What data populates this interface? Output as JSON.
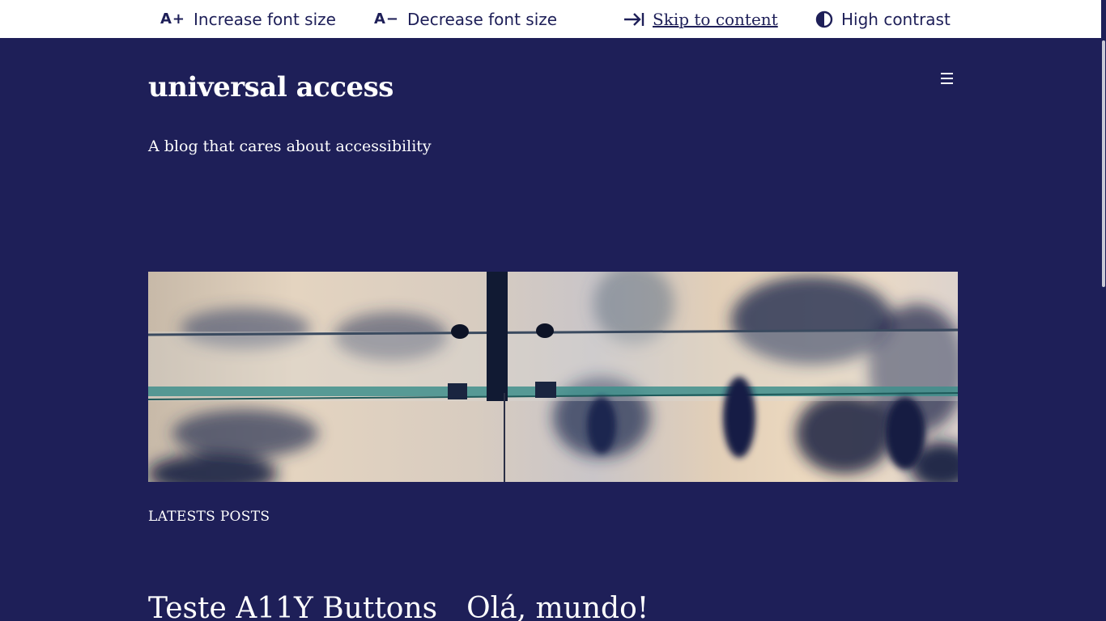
{
  "a11y_bar": {
    "increase_icon_text": "A+",
    "increase_label": "Increase font size",
    "decrease_icon_text": "A−",
    "decrease_label": "Decrease font size",
    "skip_label": "Skip to content",
    "contrast_label": "High contrast"
  },
  "header": {
    "site_title": "universal access",
    "tagline": "A blog that cares about accessibility",
    "menu_icon": "hamburger-menu-icon"
  },
  "main": {
    "section_label": "LATESTS POSTS",
    "posts": [
      {
        "title": "Teste A11Y Buttons"
      },
      {
        "title": "Olá, mundo!"
      }
    ]
  },
  "colors": {
    "background": "#1e1f58",
    "bar_background": "#ffffff",
    "text": "#ffffff",
    "bar_text": "#1e1f58"
  }
}
